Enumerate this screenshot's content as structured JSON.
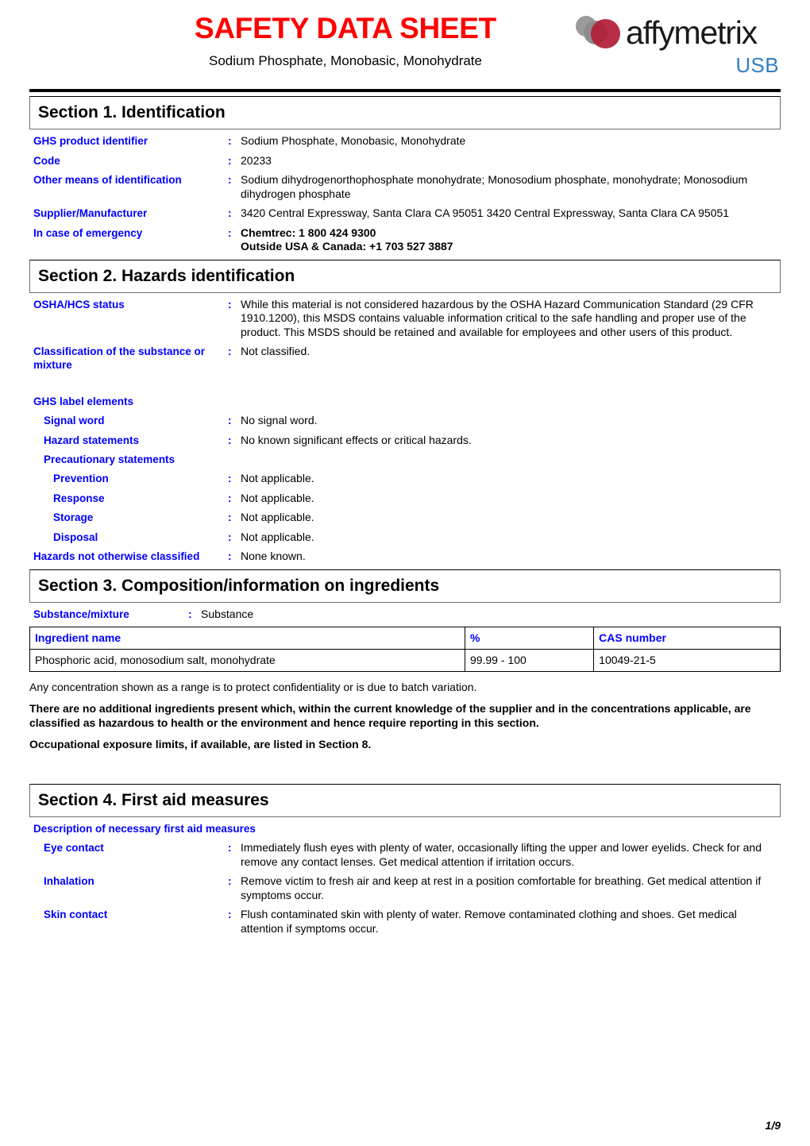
{
  "header": {
    "title": "SAFETY DATA SHEET",
    "subtitle": "Sodium Phosphate, Monobasic, Monohydrate",
    "brand_name": "affymetrix",
    "brand_sub": "USB",
    "title_color": "#ff0000",
    "brand_sub_color": "#2f7fc1",
    "label_color": "#0000ff"
  },
  "section1": {
    "heading": "Section 1. Identification",
    "rows": [
      {
        "label": "GHS product identifier",
        "colon": ":",
        "value": "Sodium Phosphate, Monobasic, Monohydrate"
      },
      {
        "label": "Code",
        "colon": ":",
        "value": "20233"
      },
      {
        "label": "Other means of identification",
        "colon": ":",
        "value": "Sodium dihydrogenorthophosphate monohydrate; Monosodium phosphate, monohydrate; Monosodium dihydrogen phosphate"
      },
      {
        "label": "Supplier/Manufacturer",
        "colon": ":",
        "value": "3420 Central Expressway, Santa Clara  CA 95051 3420 Central Expressway, Santa Clara  CA 95051"
      },
      {
        "label": "In case of emergency",
        "colon": ":",
        "value_line1": "Chemtrec: 1 800 424 9300",
        "value_line2": "Outside USA & Canada: +1 703 527 3887"
      }
    ]
  },
  "section2": {
    "heading": "Section 2. Hazards identification",
    "osha_label": "OSHA/HCS status",
    "osha_colon": ":",
    "osha_value": "While this material is not considered hazardous by the OSHA Hazard Communication Standard (29 CFR 1910.1200), this MSDS contains valuable information critical to the safe handling and proper use of the product. This MSDS should be retained and available for employees and other users of this product.",
    "classification_label": "Classification of the substance or mixture",
    "classification_colon": ":",
    "classification_value": "Not classified.",
    "ghs_group_label": "GHS label elements",
    "signal_word_label": "Signal word",
    "signal_word_colon": ":",
    "signal_word_value": "No signal word.",
    "hazard_statements_label": "Hazard statements",
    "hazard_statements_colon": ":",
    "hazard_statements_value": "No known significant effects or critical hazards.",
    "precautionary_group_label": "Precautionary statements",
    "prevention_label": "Prevention",
    "prevention_colon": ":",
    "prevention_value": "Not applicable.",
    "response_label": "Response",
    "response_colon": ":",
    "response_value": "Not applicable.",
    "storage_label": "Storage",
    "storage_colon": ":",
    "storage_value": "Not applicable.",
    "disposal_label": "Disposal",
    "disposal_colon": ":",
    "disposal_value": "Not applicable.",
    "hnoc_label": "Hazards not otherwise classified",
    "hnoc_colon": ":",
    "hnoc_value": "None known."
  },
  "section3": {
    "heading": "Section 3. Composition/information on ingredients",
    "substance_label": "Substance/mixture",
    "substance_colon": ":",
    "substance_value": "Substance",
    "table": {
      "columns": [
        "Ingredient name",
        "%",
        "CAS number"
      ],
      "rows": [
        [
          "Phosphoric acid, monosodium salt, monohydrate",
          "99.99 - 100",
          "10049-21-5"
        ]
      ]
    },
    "note": "Any concentration shown as a range is to protect confidentiality or is due to batch variation.",
    "statement": "There are no additional ingredients present which, within the current knowledge of the supplier and in the concentrations applicable, are classified as hazardous to health or the environment and hence require reporting in this section.",
    "exposure": "Occupational exposure limits, if available, are listed in Section 8."
  },
  "section4": {
    "heading": "Section 4. First aid measures",
    "group_label": "Description of necessary first aid measures",
    "eye_label": "Eye contact",
    "eye_colon": ":",
    "eye_value": "Immediately flush eyes with plenty of water, occasionally lifting the upper and lower eyelids.  Check for and remove any contact lenses.  Get medical attention if irritation occurs.",
    "inhalation_label": "Inhalation",
    "inhalation_colon": ":",
    "inhalation_value": "Remove victim to fresh air and keep at rest in a position comfortable for breathing.  Get medical attention if symptoms occur.",
    "skin_label": "Skin contact",
    "skin_colon": ":",
    "skin_value": "Flush contaminated skin with plenty of water.  Remove contaminated clothing and shoes.  Get medical attention if symptoms occur."
  },
  "footer": {
    "page": "1/9"
  }
}
